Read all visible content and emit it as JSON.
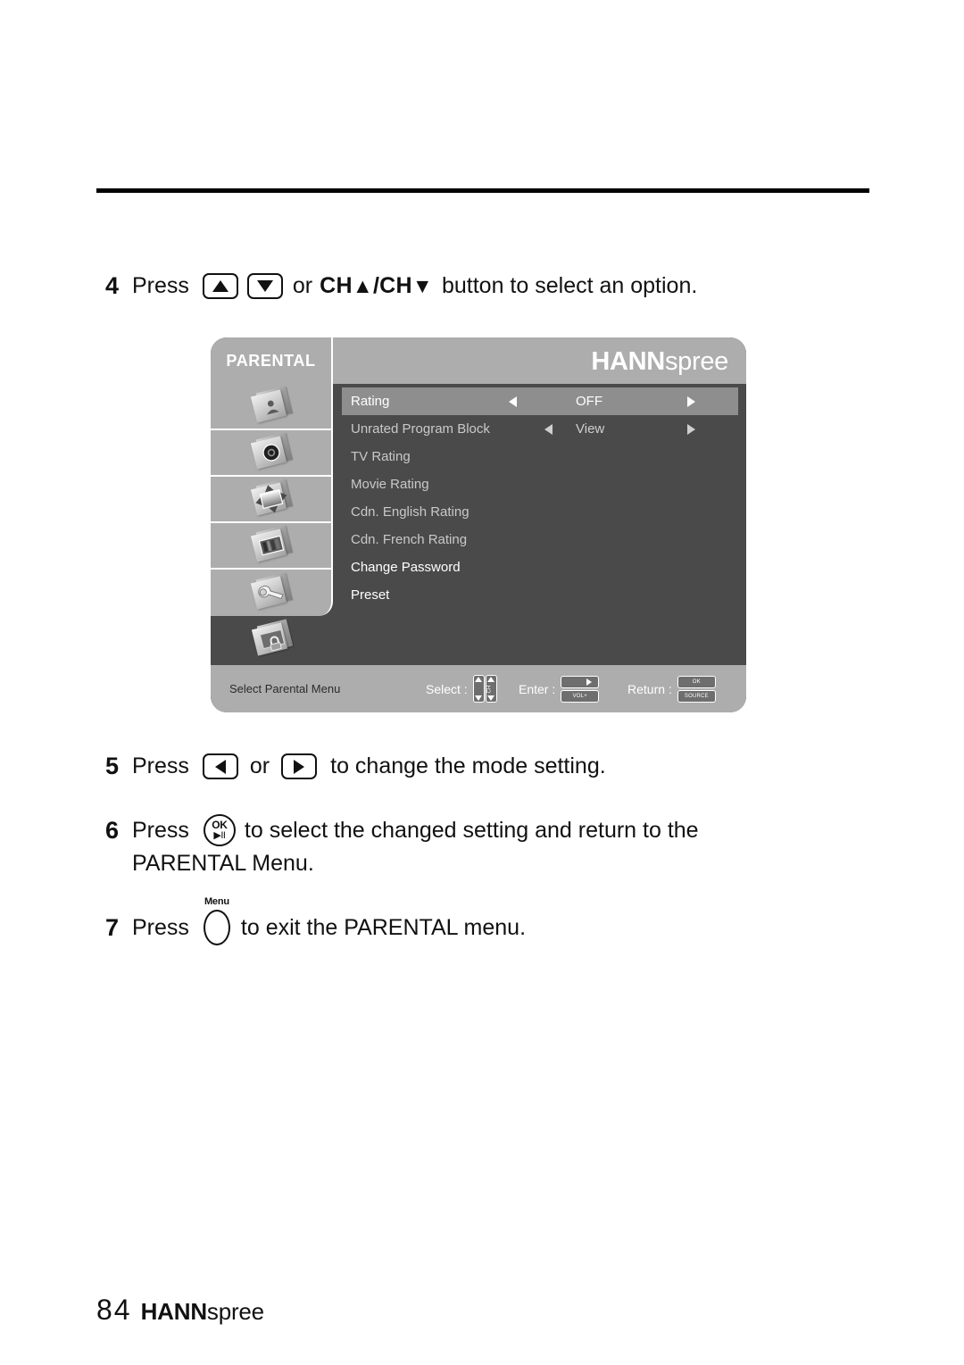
{
  "page": {
    "number": "84",
    "brand_bold": "HANN",
    "brand_light": "spree"
  },
  "steps": [
    {
      "num": "4",
      "press": "Press",
      "mid": "or",
      "ch_label_bold": "CH",
      "ch_sep": "/CH",
      "tail": "button to select an option."
    },
    {
      "num": "5",
      "press": "Press",
      "mid": "or",
      "tail": "to change the mode setting."
    },
    {
      "num": "6",
      "press": "Press",
      "ok_top": "OK",
      "ok_bottom": "▶II",
      "tail": "to select the changed setting and return to the",
      "tail2": "PARENTAL Menu."
    },
    {
      "num": "7",
      "press": "Press",
      "menu_label": "Menu",
      "tail": "to exit the PARENTAL menu."
    }
  ],
  "osd": {
    "title": "PARENTAL",
    "brand_bold": "HANN",
    "brand_light": "spree",
    "sidebar": [
      {
        "name": "picture-icon",
        "label": "Picture"
      },
      {
        "name": "audio-icon",
        "label": "Audio"
      },
      {
        "name": "screen-position-icon",
        "label": "Screen"
      },
      {
        "name": "display-icon",
        "label": "Display"
      },
      {
        "name": "setup-tools-icon",
        "label": "Setup"
      },
      {
        "name": "parental-lock-icon",
        "label": "Parental"
      }
    ],
    "menu_rows": [
      {
        "label": "Rating",
        "value": "OFF",
        "selected": true,
        "has_arrows": true,
        "dim": false
      },
      {
        "label": "Unrated Program Block",
        "value": "View",
        "selected": false,
        "has_arrows": true,
        "dim": true
      },
      {
        "label": "TV Rating",
        "value": "",
        "selected": false,
        "has_arrows": false,
        "dim": true
      },
      {
        "label": "Movie Rating",
        "value": "",
        "selected": false,
        "has_arrows": false,
        "dim": true
      },
      {
        "label": "Cdn. English Rating",
        "value": "",
        "selected": false,
        "has_arrows": false,
        "dim": true
      },
      {
        "label": "Cdn. French Rating",
        "value": "",
        "selected": false,
        "has_arrows": false,
        "dim": true
      },
      {
        "label": "Change Password",
        "value": "",
        "selected": false,
        "has_arrows": false,
        "dim": false
      },
      {
        "label": "Preset",
        "value": "",
        "selected": false,
        "has_arrows": false,
        "dim": false
      }
    ],
    "footer": {
      "hint": "Select Parental Menu",
      "select_label": "Select :",
      "select_key": "CH",
      "enter_label": "Enter :",
      "enter_key": "VOL+",
      "return_label": "Return :",
      "return_key_top": "OK",
      "return_key_bottom": "SOURCE"
    }
  },
  "colors": {
    "osd_body": "#4a4a4a",
    "osd_bar": "#adadad",
    "osd_highlight": "#8e8e8e",
    "text_dim": "#c9c9c9",
    "text_bright": "#ffffff"
  }
}
